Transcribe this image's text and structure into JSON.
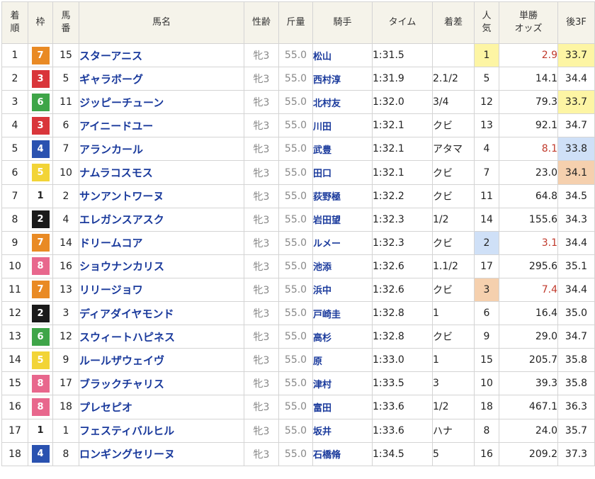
{
  "headers": {
    "rank": "着順",
    "frame": "枠",
    "number": "馬番",
    "name": "馬名",
    "sexage": "性齢",
    "weight": "斤量",
    "jockey": "騎手",
    "time": "タイム",
    "margin": "着差",
    "popularity": "人気",
    "odds": "単勝オッズ",
    "last3f": "後3F"
  },
  "frame_colors": {
    "1": {
      "bg": "#ffffff",
      "fg": "#222222"
    },
    "2": {
      "bg": "#1a1a1a",
      "fg": "#ffffff"
    },
    "3": {
      "bg": "#d9353a",
      "fg": "#ffffff"
    },
    "4": {
      "bg": "#2a52b0",
      "fg": "#ffffff"
    },
    "5": {
      "bg": "#f2d437",
      "fg": "#ffffff"
    },
    "6": {
      "bg": "#3ea548",
      "fg": "#ffffff"
    },
    "7": {
      "bg": "#e98a24",
      "fg": "#ffffff"
    },
    "8": {
      "bg": "#e8678d",
      "fg": "#ffffff"
    }
  },
  "rows": [
    {
      "rank": "1",
      "frame": "7",
      "number": "15",
      "name": "スターアニス",
      "sexage": "牝3",
      "weight": "55.0",
      "jockey": "松山",
      "time": "1:31.5",
      "margin": "",
      "popularity": "1",
      "odds": "2.9",
      "last3f": "33.7",
      "pop_hl": "yellow",
      "odds_hot": true,
      "last3f_hl": "yellow"
    },
    {
      "rank": "2",
      "frame": "3",
      "number": "5",
      "name": "ギャラボーグ",
      "sexage": "牝3",
      "weight": "55.0",
      "jockey": "西村淳",
      "time": "1:31.9",
      "margin": "2.1/2",
      "popularity": "5",
      "odds": "14.1",
      "last3f": "34.4",
      "pop_hl": "",
      "odds_hot": false,
      "last3f_hl": ""
    },
    {
      "rank": "3",
      "frame": "6",
      "number": "11",
      "name": "ジッピーチューン",
      "sexage": "牝3",
      "weight": "55.0",
      "jockey": "北村友",
      "time": "1:32.0",
      "margin": "3/4",
      "popularity": "12",
      "odds": "79.3",
      "last3f": "33.7",
      "pop_hl": "",
      "odds_hot": false,
      "last3f_hl": "yellow"
    },
    {
      "rank": "4",
      "frame": "3",
      "number": "6",
      "name": "アイニードユー",
      "sexage": "牝3",
      "weight": "55.0",
      "jockey": "川田",
      "time": "1:32.1",
      "margin": "クビ",
      "popularity": "13",
      "odds": "92.1",
      "last3f": "34.7",
      "pop_hl": "",
      "odds_hot": false,
      "last3f_hl": ""
    },
    {
      "rank": "5",
      "frame": "4",
      "number": "7",
      "name": "アランカール",
      "sexage": "牝3",
      "weight": "55.0",
      "jockey": "武豊",
      "time": "1:32.1",
      "margin": "アタマ",
      "popularity": "4",
      "odds": "8.1",
      "last3f": "33.8",
      "pop_hl": "",
      "odds_hot": true,
      "last3f_hl": "blue"
    },
    {
      "rank": "6",
      "frame": "5",
      "number": "10",
      "name": "ナムラコスモス",
      "sexage": "牝3",
      "weight": "55.0",
      "jockey": "田口",
      "time": "1:32.1",
      "margin": "クビ",
      "popularity": "7",
      "odds": "23.0",
      "last3f": "34.1",
      "pop_hl": "",
      "odds_hot": false,
      "last3f_hl": "orange"
    },
    {
      "rank": "7",
      "frame": "1",
      "number": "2",
      "name": "サンアントワーヌ",
      "sexage": "牝3",
      "weight": "55.0",
      "jockey": "荻野極",
      "time": "1:32.2",
      "margin": "クビ",
      "popularity": "11",
      "odds": "64.8",
      "last3f": "34.5",
      "pop_hl": "",
      "odds_hot": false,
      "last3f_hl": ""
    },
    {
      "rank": "8",
      "frame": "2",
      "number": "4",
      "name": "エレガンスアスク",
      "sexage": "牝3",
      "weight": "55.0",
      "jockey": "岩田望",
      "time": "1:32.3",
      "margin": "1/2",
      "popularity": "14",
      "odds": "155.6",
      "last3f": "34.3",
      "pop_hl": "",
      "odds_hot": false,
      "last3f_hl": ""
    },
    {
      "rank": "9",
      "frame": "7",
      "number": "14",
      "name": "ドリームコア",
      "sexage": "牝3",
      "weight": "55.0",
      "jockey": "ルメー",
      "time": "1:32.3",
      "margin": "クビ",
      "popularity": "2",
      "odds": "3.1",
      "last3f": "34.4",
      "pop_hl": "blue",
      "odds_hot": true,
      "last3f_hl": ""
    },
    {
      "rank": "10",
      "frame": "8",
      "number": "16",
      "name": "ショウナンカリス",
      "sexage": "牝3",
      "weight": "55.0",
      "jockey": "池添",
      "time": "1:32.6",
      "margin": "1.1/2",
      "popularity": "17",
      "odds": "295.6",
      "last3f": "35.1",
      "pop_hl": "",
      "odds_hot": false,
      "last3f_hl": ""
    },
    {
      "rank": "11",
      "frame": "7",
      "number": "13",
      "name": "リリージョワ",
      "sexage": "牝3",
      "weight": "55.0",
      "jockey": "浜中",
      "time": "1:32.6",
      "margin": "クビ",
      "popularity": "3",
      "odds": "7.4",
      "last3f": "34.4",
      "pop_hl": "orange",
      "odds_hot": true,
      "last3f_hl": ""
    },
    {
      "rank": "12",
      "frame": "2",
      "number": "3",
      "name": "ディアダイヤモンド",
      "sexage": "牝3",
      "weight": "55.0",
      "jockey": "戸崎圭",
      "time": "1:32.8",
      "margin": "1",
      "popularity": "6",
      "odds": "16.4",
      "last3f": "35.0",
      "pop_hl": "",
      "odds_hot": false,
      "last3f_hl": ""
    },
    {
      "rank": "13",
      "frame": "6",
      "number": "12",
      "name": "スウィートハピネス",
      "sexage": "牝3",
      "weight": "55.0",
      "jockey": "高杉",
      "time": "1:32.8",
      "margin": "クビ",
      "popularity": "9",
      "odds": "29.0",
      "last3f": "34.7",
      "pop_hl": "",
      "odds_hot": false,
      "last3f_hl": ""
    },
    {
      "rank": "14",
      "frame": "5",
      "number": "9",
      "name": "ルールザウェイヴ",
      "sexage": "牝3",
      "weight": "55.0",
      "jockey": "原",
      "time": "1:33.0",
      "margin": "1",
      "popularity": "15",
      "odds": "205.7",
      "last3f": "35.8",
      "pop_hl": "",
      "odds_hot": false,
      "last3f_hl": ""
    },
    {
      "rank": "15",
      "frame": "8",
      "number": "17",
      "name": "ブラックチャリス",
      "sexage": "牝3",
      "weight": "55.0",
      "jockey": "津村",
      "time": "1:33.5",
      "margin": "3",
      "popularity": "10",
      "odds": "39.3",
      "last3f": "35.8",
      "pop_hl": "",
      "odds_hot": false,
      "last3f_hl": ""
    },
    {
      "rank": "16",
      "frame": "8",
      "number": "18",
      "name": "プレセピオ",
      "sexage": "牝3",
      "weight": "55.0",
      "jockey": "富田",
      "time": "1:33.6",
      "margin": "1/2",
      "popularity": "18",
      "odds": "467.1",
      "last3f": "36.3",
      "pop_hl": "",
      "odds_hot": false,
      "last3f_hl": ""
    },
    {
      "rank": "17",
      "frame": "1",
      "number": "1",
      "name": "フェスティバルヒル",
      "sexage": "牝3",
      "weight": "55.0",
      "jockey": "坂井",
      "time": "1:33.6",
      "margin": "ハナ",
      "popularity": "8",
      "odds": "24.0",
      "last3f": "35.7",
      "pop_hl": "",
      "odds_hot": false,
      "last3f_hl": ""
    },
    {
      "rank": "18",
      "frame": "4",
      "number": "8",
      "name": "ロンギングセリーヌ",
      "sexage": "牝3",
      "weight": "55.0",
      "jockey": "石橋脩",
      "time": "1:34.5",
      "margin": "5",
      "popularity": "16",
      "odds": "209.2",
      "last3f": "37.3",
      "pop_hl": "",
      "odds_hot": false,
      "last3f_hl": ""
    }
  ]
}
